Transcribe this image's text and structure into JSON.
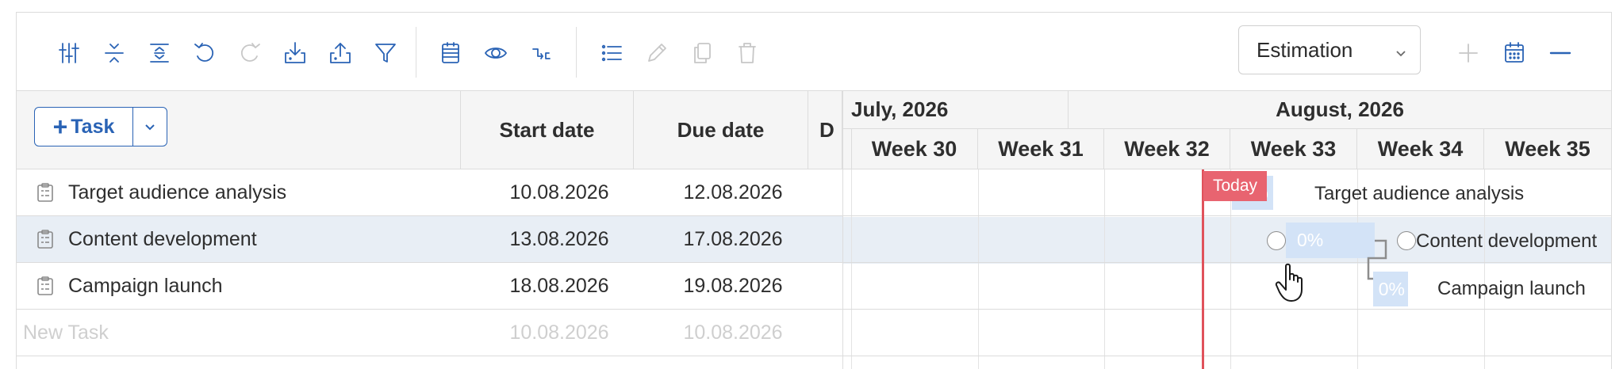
{
  "toolbar": {
    "icons": [
      "column-settings-icon",
      "collapse-all-icon",
      "expand-all-icon",
      "undo-icon",
      "redo-icon",
      "import-icon",
      "export-icon",
      "filter-icon",
      "schedule-icon",
      "view-icon",
      "dependencies-icon",
      "list-icon",
      "edit-icon",
      "copy-icon",
      "delete-icon"
    ],
    "estimation_select": "Estimation",
    "right_icons": [
      "add-icon",
      "calendar-icon",
      "zoom-out-icon"
    ]
  },
  "grid": {
    "add_task_label": "Task",
    "columns": [
      "Start date",
      "Due date",
      "D"
    ],
    "rows": [
      {
        "name": "Target audience analysis",
        "start": "10.08.2026",
        "due": "12.08.2026"
      },
      {
        "name": "Content development",
        "start": "13.08.2026",
        "due": "17.08.2026"
      },
      {
        "name": "Campaign launch",
        "start": "18.08.2026",
        "due": "19.08.2026"
      }
    ],
    "new_task": {
      "name": "New Task",
      "start": "10.08.2026",
      "due": "10.08.2026"
    }
  },
  "timeline": {
    "months": [
      "July, 2026",
      "August, 2026"
    ],
    "weeks": [
      "Week 30",
      "Week 31",
      "Week 32",
      "Week 33",
      "Week 34",
      "Week 35"
    ],
    "today_label": "Today",
    "bars": [
      {
        "name": "Target audience analysis",
        "progress": "%"
      },
      {
        "name": "Content development",
        "progress": "0%"
      },
      {
        "name": "Campaign launch",
        "progress": "0%"
      }
    ]
  },
  "colors": {
    "accent": "#2a63b5",
    "today": "#e0525b",
    "bar": "#d3e3f7",
    "selected_row": "#e8eef5"
  }
}
